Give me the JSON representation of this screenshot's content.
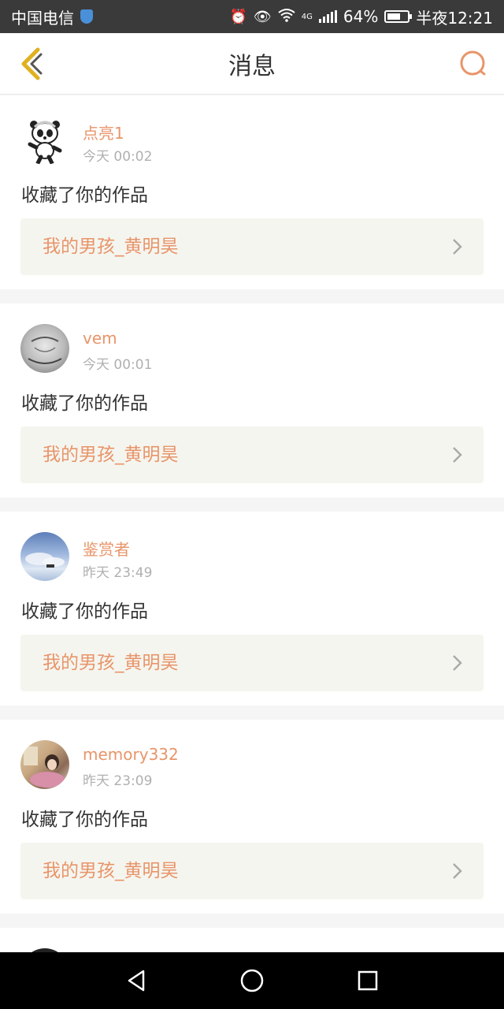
{
  "status_bar": {
    "carrier": "中国电信",
    "network": "4G",
    "battery": "64%",
    "battery_level": 0.64,
    "time": "半夜12:21"
  },
  "header": {
    "title": "消息"
  },
  "colors": {
    "accent": "#e8956a",
    "back_icon": "#e0b020",
    "text_primary": "#333333",
    "text_secondary": "#b0b0b0",
    "link_bg": "#f5f5ef"
  },
  "notifications": [
    {
      "username": "点亮1",
      "time": "今天 00:02",
      "action": "收藏了你的作品",
      "work_title": "我的男孩_黄明昊",
      "avatar_icon": "panda-avatar"
    },
    {
      "username": "vem",
      "time": "今天 00:01",
      "action": "收藏了你的作品",
      "work_title": "我的男孩_黄明昊",
      "avatar_icon": "sketch-avatar"
    },
    {
      "username": "鉴赏者",
      "time": "昨天 23:49",
      "action": "收藏了你的作品",
      "work_title": "我的男孩_黄明昊",
      "avatar_icon": "sky-avatar"
    },
    {
      "username": "memory332",
      "time": "昨天 23:09",
      "action": "收藏了你的作品",
      "work_title": "我的男孩_黄明昊",
      "avatar_icon": "photo-avatar"
    }
  ],
  "nav": {
    "icons": [
      "back-triangle-icon",
      "home-circle-icon",
      "recents-square-icon"
    ]
  }
}
